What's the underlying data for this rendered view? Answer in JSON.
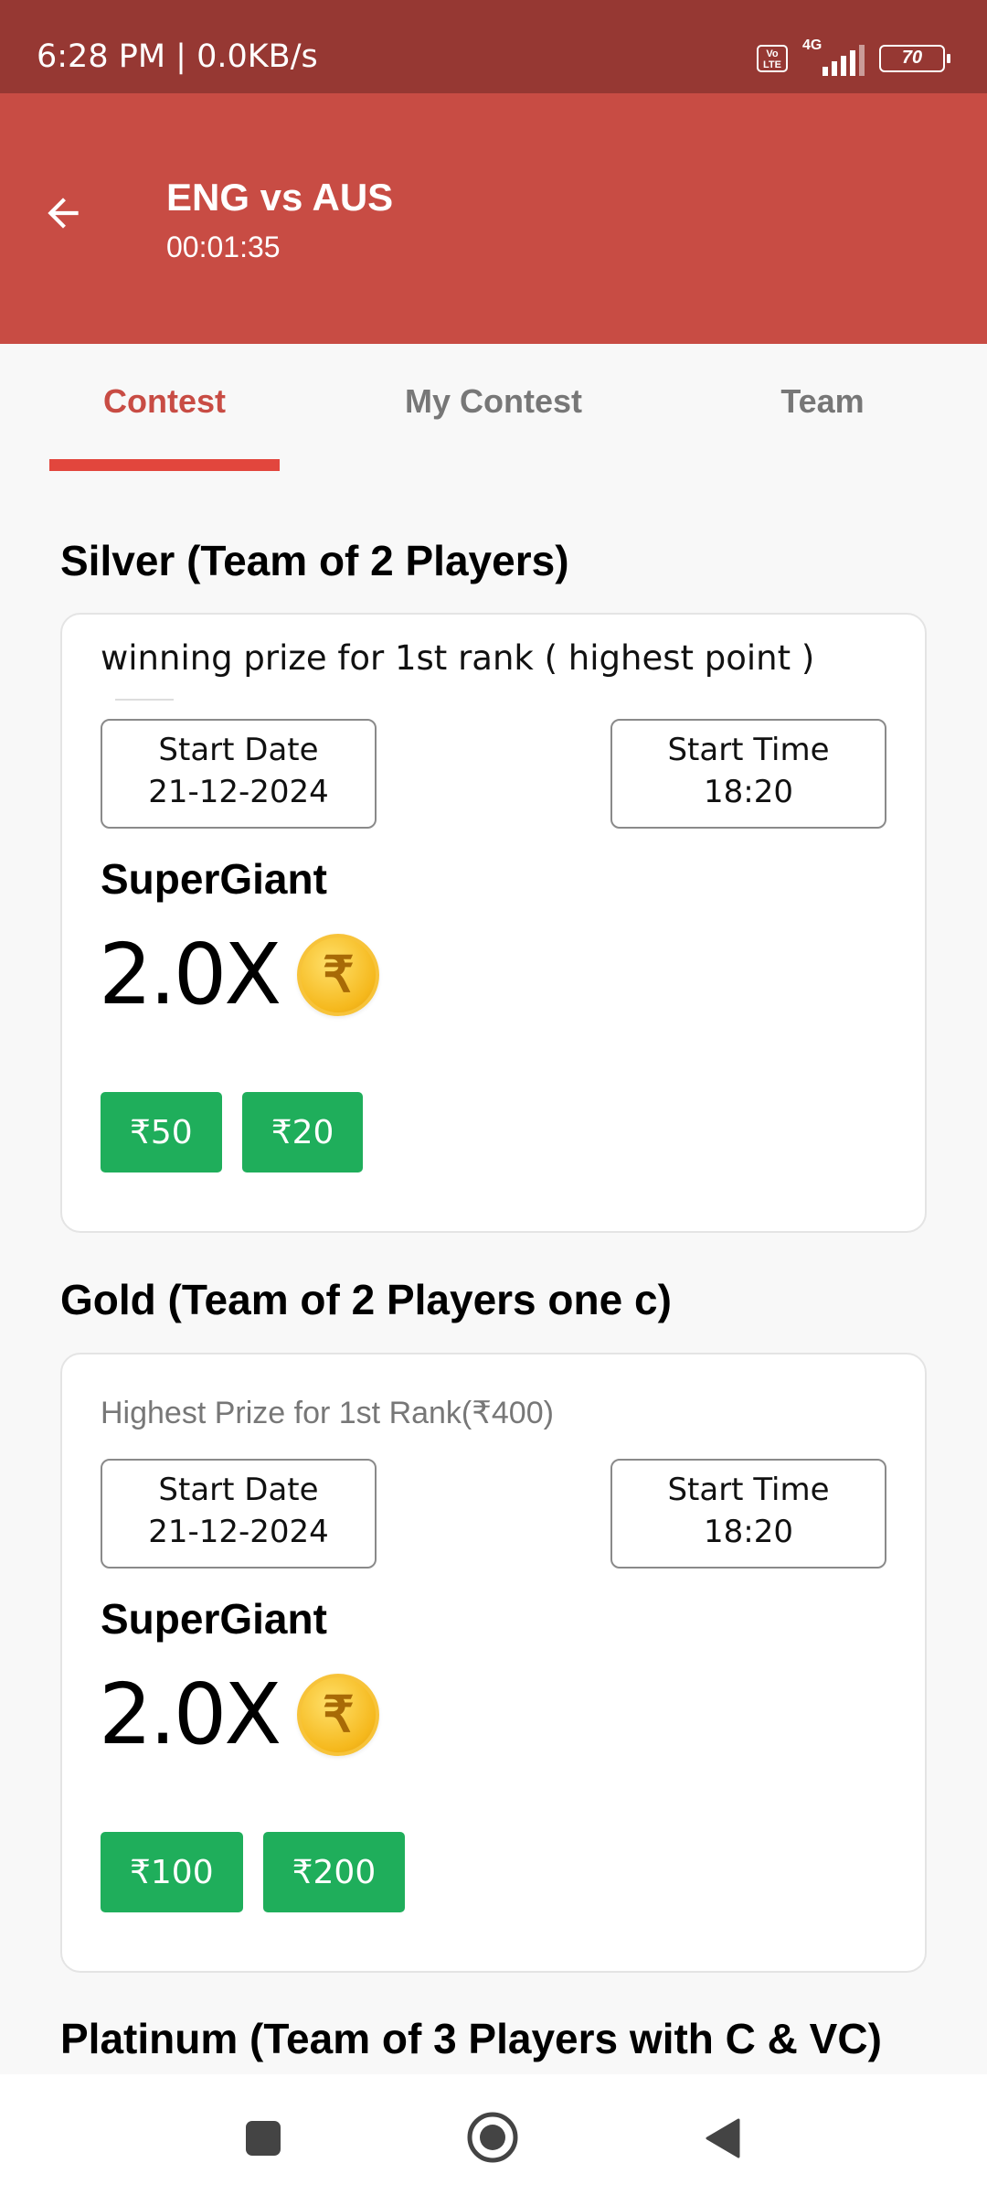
{
  "status_bar": {
    "time": "6:28 PM | 0.0KB/s",
    "volte": "Vo LTE",
    "network": "4G",
    "battery": "70"
  },
  "app_bar": {
    "title": "ENG vs AUS",
    "timer": "00:01:35",
    "back_icon": "arrow-left-icon"
  },
  "tabs": [
    {
      "label": "Contest",
      "active": true
    },
    {
      "label": "My Contest",
      "active": false
    },
    {
      "label": "Team",
      "active": false
    }
  ],
  "colors": {
    "status_bar": "#963833",
    "app_bar": "#c84c44",
    "tab_active": "#c84c44",
    "tab_indicator": "#e2463d",
    "fee_button": "#1fae5b",
    "coin": "#f5b81c"
  },
  "contests": [
    {
      "title": "Silver (Team of 2 Players)",
      "subtitle": "winning prize for 1st rank ( highest point )",
      "start_date_label": "Start Date",
      "start_date": "21-12-2024",
      "start_time_label": "Start Time",
      "start_time": "18:20",
      "brand": "SuperGiant",
      "multiplier": "2.0X",
      "coin_symbol": "₹",
      "entry_fees": [
        "₹50",
        "₹20"
      ]
    },
    {
      "title": "Gold (Team of 2 Players one c)",
      "subtitle": "Highest Prize for 1st Rank(₹400)",
      "start_date_label": "Start Date",
      "start_date": "21-12-2024",
      "start_time_label": "Start Time",
      "start_time": "18:20",
      "brand": "SuperGiant",
      "multiplier": "2.0X",
      "coin_symbol": "₹",
      "entry_fees": [
        "₹100",
        "₹200"
      ]
    },
    {
      "title": "Platinum (Team of 3 Players with C & VC)"
    }
  ],
  "nav_bar": {
    "icons": [
      "recent-apps-icon",
      "home-icon",
      "back-icon"
    ]
  }
}
